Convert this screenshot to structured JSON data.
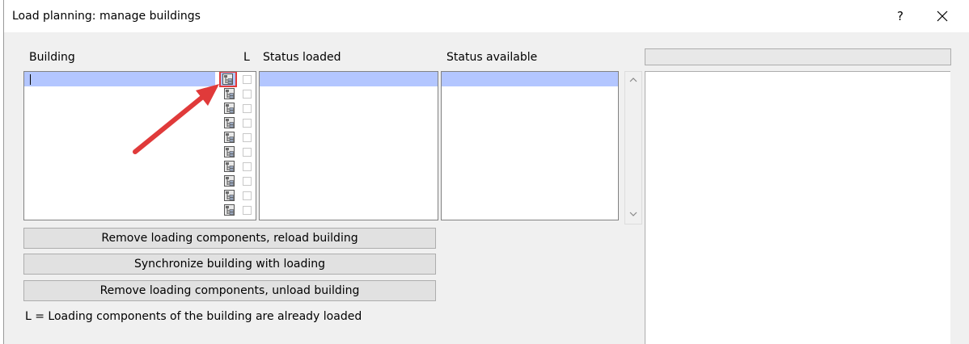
{
  "window": {
    "title": "Load planning: manage buildings",
    "help": "?"
  },
  "columns": {
    "building": "Building",
    "loaded_flag": "L",
    "status_loaded": "Status loaded",
    "status_available": "Status available"
  },
  "building_rows": 10,
  "buttons": {
    "reload": "Remove loading components, reload building",
    "sync": "Synchronize building with loading",
    "unload": "Remove loading components, unload building"
  },
  "legend": "L = Loading components of the building are already loaded",
  "colors": {
    "selection": "#b3c6ff",
    "highlight": "#e03a3a"
  }
}
